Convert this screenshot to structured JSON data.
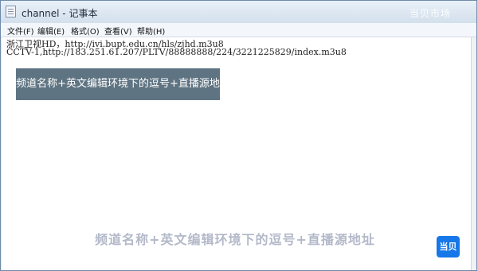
{
  "window": {
    "title": "channel - 记事本",
    "watermark": "当贝市场"
  },
  "menu": {
    "items": [
      "文件(F)",
      "编辑(E)",
      "格式(O)",
      "查看(V)",
      "帮助(H)"
    ]
  },
  "editor": {
    "line1": "浙江卫视HD，http://ivi.bupt.edu.cn/hls/zjhd.m3u8",
    "line2": "CCTV-1,http://183.251.61.207/PLTV/88888888/224/3221225829/index.m3u8"
  },
  "callout": {
    "text": "频道名称+英文编辑环境下的逗号+直播源地址"
  },
  "caption": {
    "text": "频道名称+英文编辑环境下的逗号+直播源地址"
  },
  "logo": {
    "text": "当贝"
  },
  "colors": {
    "callout_bg": "#5f7482",
    "logo_bg": "#1677e8"
  }
}
